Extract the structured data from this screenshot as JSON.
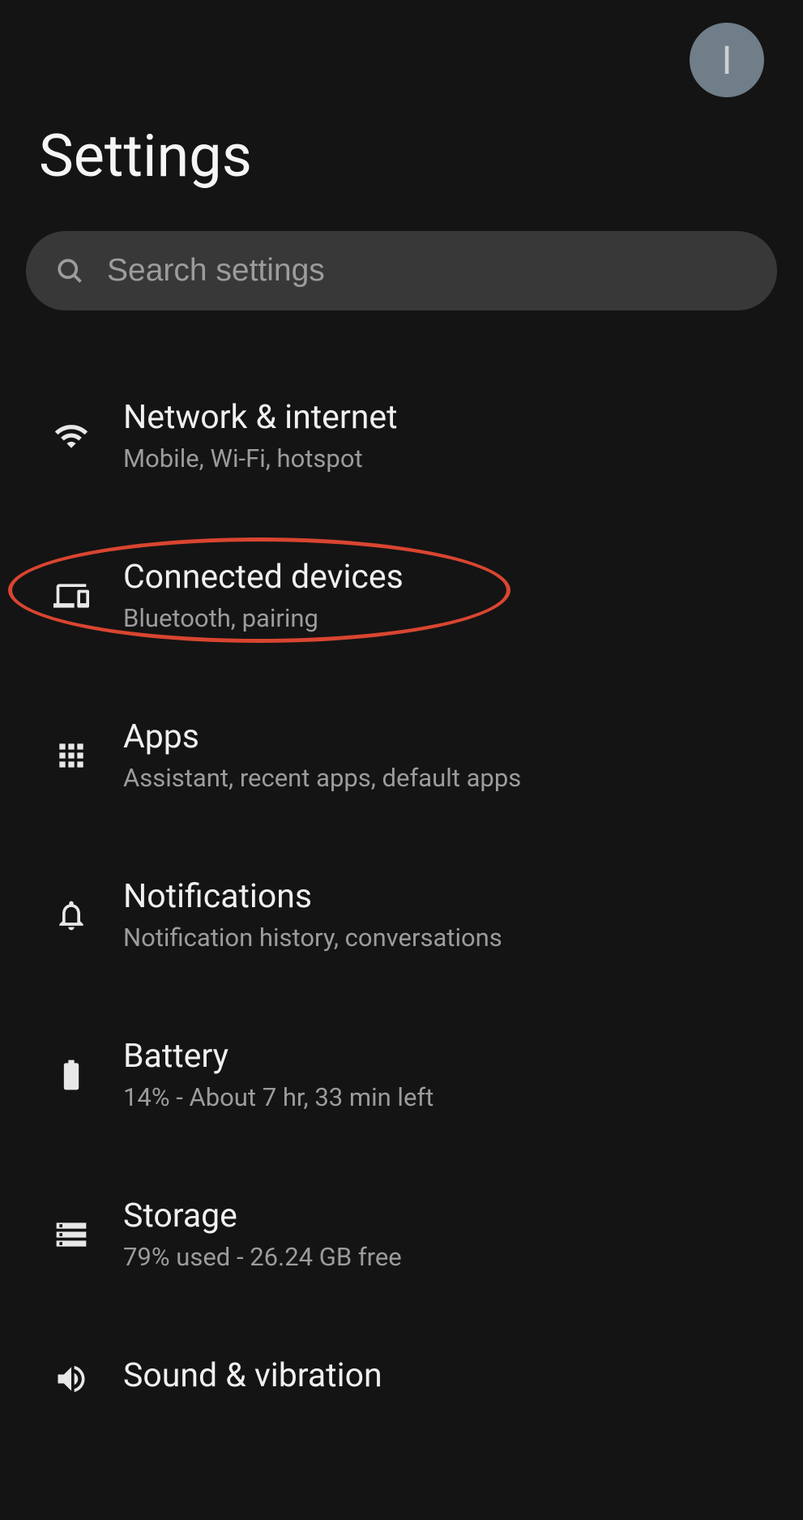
{
  "header": {
    "avatar_letter": "I",
    "title": "Settings"
  },
  "search": {
    "placeholder": "Search settings"
  },
  "items": [
    {
      "icon": "wifi",
      "title": "Network & internet",
      "sub": "Mobile, Wi-Fi, hotspot",
      "highlighted": false
    },
    {
      "icon": "devices",
      "title": "Connected devices",
      "sub": "Bluetooth, pairing",
      "highlighted": true
    },
    {
      "icon": "apps",
      "title": "Apps",
      "sub": "Assistant, recent apps, default apps",
      "highlighted": false
    },
    {
      "icon": "bell",
      "title": "Notifications",
      "sub": "Notification history, conversations",
      "highlighted": false
    },
    {
      "icon": "battery",
      "title": "Battery",
      "sub": "14% - About 7 hr, 33 min left",
      "highlighted": false
    },
    {
      "icon": "storage",
      "title": "Storage",
      "sub": "79% used - 26.24 GB free",
      "highlighted": false
    },
    {
      "icon": "sound",
      "title": "Sound & vibration",
      "sub": "",
      "highlighted": false
    }
  ]
}
